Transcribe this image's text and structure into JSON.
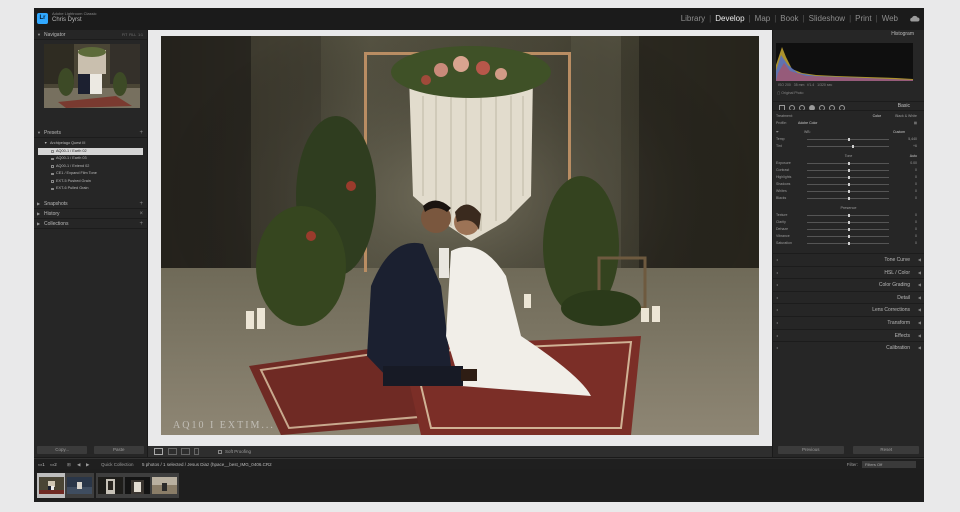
{
  "window": {
    "app_name": "Adobe Lightroom Classic",
    "user_name": "Chris Dyrst",
    "modules": [
      "Library",
      "Develop",
      "Map",
      "Book",
      "Slideshow",
      "Print",
      "Web"
    ],
    "active_module": "Develop"
  },
  "left_panel": {
    "navigator_label": "Navigator",
    "navigator_options": [
      "FIT",
      "FILL",
      "1:1"
    ],
    "presets_label": "Presets",
    "preset_group": "Archipelago Quest III",
    "presets": [
      "AQ00-1 / Earth 02",
      "AQ00-1 / Earth 03",
      "AQ00-1 / Extend 02",
      "CE1 / Expand Film Tone",
      "EXT-5 Pushed Grain",
      "EXT-6 Pulled Grain"
    ],
    "selected_preset_index": 0,
    "snapshots_label": "Snapshots",
    "history_label": "History",
    "collections_label": "Collections",
    "copy_label": "Copy...",
    "paste_label": "Paste"
  },
  "photo": {
    "watermark": "AQ10 I  EXTIM..."
  },
  "toolbar": {
    "soft_proofing_label": "Soft Proofing"
  },
  "right_panel": {
    "histogram_label": "Histogram",
    "histogram_info": [
      "ISO 200",
      "35 mm",
      "f/1.4",
      "1/320 sec"
    ],
    "original_photo_label": "Original Photo",
    "basic_label": "Basic",
    "treatment_label": "Treatment:",
    "treatment_options": [
      "Color",
      "Black & White"
    ],
    "profile_label": "Profile:",
    "profile_value": "Adobe Color",
    "wb_label": "WB:",
    "wb_value": "Custom",
    "sliders_wb": [
      {
        "label": "Temp",
        "value": "5,440",
        "level": 0.5
      },
      {
        "label": "Tint",
        "value": "+6",
        "level": 0.55
      }
    ],
    "tone_label": "Tone",
    "tone_auto": "Auto",
    "sliders_tone": [
      {
        "label": "Exposure",
        "value": "0.00",
        "level": 0.5
      },
      {
        "label": "Contrast",
        "value": "0",
        "level": 0.5
      },
      {
        "label": "Highlights",
        "value": "0",
        "level": 0.5
      },
      {
        "label": "Shadows",
        "value": "0",
        "level": 0.5
      },
      {
        "label": "Whites",
        "value": "0",
        "level": 0.5
      },
      {
        "label": "Blacks",
        "value": "0",
        "level": 0.5
      }
    ],
    "presence_label": "Presence",
    "sliders_presence": [
      {
        "label": "Texture",
        "value": "0",
        "level": 0.5
      },
      {
        "label": "Clarity",
        "value": "0",
        "level": 0.5
      },
      {
        "label": "Dehaze",
        "value": "0",
        "level": 0.5
      },
      {
        "label": "Vibrance",
        "value": "0",
        "level": 0.5
      },
      {
        "label": "Saturation",
        "value": "0",
        "level": 0.5
      }
    ],
    "panels": [
      "Tone Curve",
      "HSL / Color",
      "Color Grading",
      "Detail",
      "Lens Corrections",
      "Transform",
      "Effects",
      "Calibration"
    ],
    "previous_label": "Previous",
    "reset_label": "Reset"
  },
  "filmstrip": {
    "source_label": "Quick Collection",
    "info": "5 photos / 1 selected / Jesus Diaz (hpace__best_IMG_0406.CR2",
    "filter_label": "Filter:",
    "filter_value": "Filters Off",
    "thumb_count": 5,
    "selected_index": 0
  }
}
